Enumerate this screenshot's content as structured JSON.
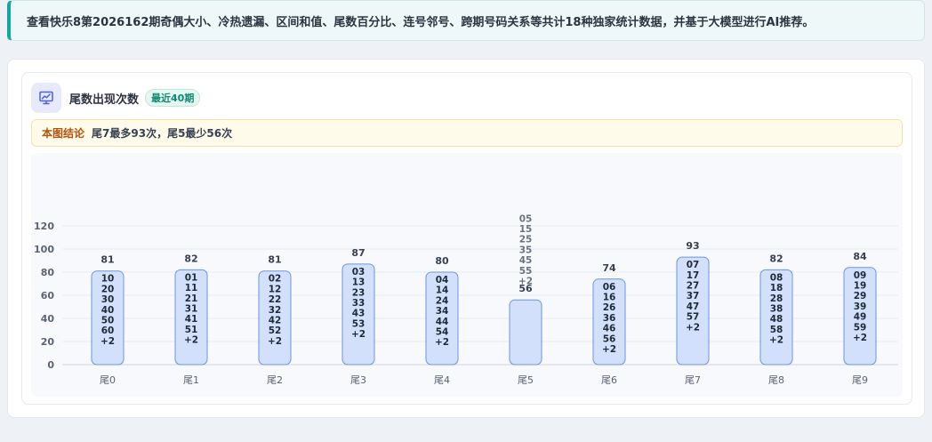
{
  "banner": {
    "text": "查看快乐8第2026162期奇偶大小、冷热遗漏、区间和值、尾数百分比、连号邻号、跨期号码关系等共计18种独家统计数据，并基于大模型进行AI推荐。"
  },
  "card": {
    "icon": "chart-presentation-icon",
    "title": "尾数出现次数",
    "badge": "最近40期",
    "conclusion_tag": "本图结论",
    "conclusion_text": "尾7最多93次，尾5最少56次"
  },
  "colors": {
    "bar_fill": "#d3e0fb",
    "bar_stroke": "#6f93de",
    "accent": "#14a6a0"
  },
  "chart_data": {
    "type": "bar",
    "title": "",
    "xlabel": "",
    "ylabel": "",
    "categories": [
      "尾0",
      "尾1",
      "尾2",
      "尾3",
      "尾4",
      "尾5",
      "尾6",
      "尾7",
      "尾8",
      "尾9"
    ],
    "values": [
      81,
      82,
      81,
      87,
      80,
      56,
      74,
      93,
      82,
      84
    ],
    "bar_labels": [
      [
        "10",
        "20",
        "30",
        "40",
        "50",
        "60",
        "+2"
      ],
      [
        "01",
        "11",
        "21",
        "31",
        "41",
        "51",
        "+2"
      ],
      [
        "02",
        "12",
        "22",
        "32",
        "42",
        "52",
        "+2"
      ],
      [
        "03",
        "13",
        "23",
        "33",
        "43",
        "53",
        "+2"
      ],
      [
        "04",
        "14",
        "24",
        "34",
        "44",
        "54",
        "+2"
      ],
      [
        "05",
        "15",
        "25",
        "35",
        "45",
        "55",
        "+2"
      ],
      [
        "06",
        "16",
        "26",
        "36",
        "46",
        "56",
        "+2"
      ],
      [
        "07",
        "17",
        "27",
        "37",
        "47",
        "57",
        "+2"
      ],
      [
        "08",
        "18",
        "28",
        "38",
        "48",
        "58",
        "+2"
      ],
      [
        "09",
        "19",
        "29",
        "39",
        "49",
        "59",
        "+2"
      ]
    ],
    "yticks": [
      0,
      20,
      40,
      60,
      80,
      100,
      120
    ],
    "ylim": [
      0,
      120
    ],
    "grid": true,
    "legend": "none"
  }
}
